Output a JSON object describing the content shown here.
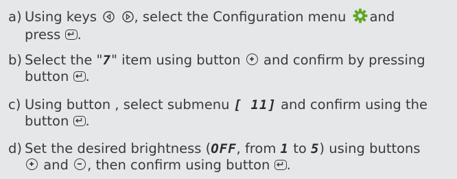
{
  "steps": [
    {
      "label": "a)",
      "t1": "Using keys",
      "t2": ", select the Configuration menu",
      "t3": "and",
      "t4": "press",
      "t5": "."
    },
    {
      "label": "b)",
      "t1": "Select the \"",
      "seg1": "7",
      "t2": "\" item using button",
      "t3": "and confirm by pressing",
      "t4": "button",
      "t5": "."
    },
    {
      "label": "c)",
      "t1": "Using button , select submenu",
      "seg1": "[ 11]",
      "t2": "and confirm using the",
      "t3": "button",
      "t4": "."
    },
    {
      "label": "d)",
      "t1": "Set the desired brightness (",
      "seg1": "OFF",
      "t2": ", from",
      "seg2": "1",
      "t3": "to",
      "seg3": "5",
      "t4": ") using buttons",
      "t5": "and",
      "t6": ", then confirm using button",
      "t7": "."
    }
  ],
  "icons": {
    "left": "circle-left-arrow-icon",
    "right": "circle-right-arrow-icon",
    "gear": "gear-icon",
    "enter": "enter-key-icon",
    "plus": "plus-key-icon",
    "minus": "minus-key-icon"
  },
  "colors": {
    "background": "#e6e7e8",
    "text": "#3a3a3c",
    "gear": "#5fa82a"
  }
}
